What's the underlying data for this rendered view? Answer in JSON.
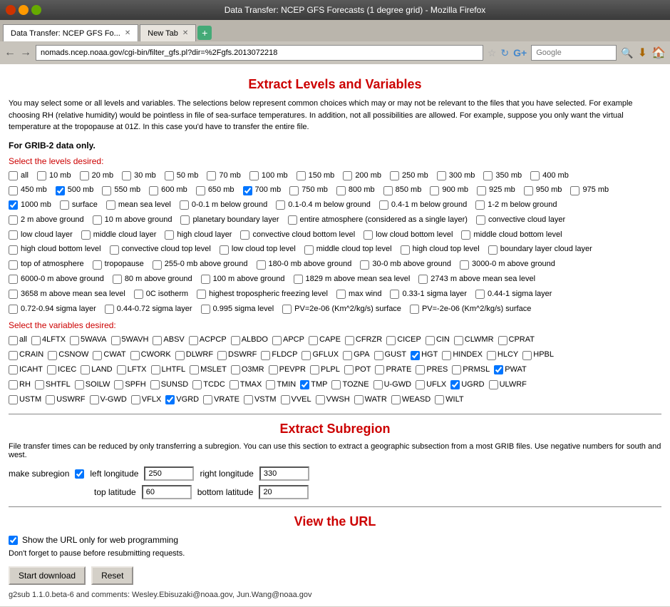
{
  "titlebar": {
    "title": "Data Transfer: NCEP GFS Forecasts (1 degree grid) - Mozilla Firefox"
  },
  "tabs": [
    {
      "label": "Data Transfer: NCEP GFS Fo...",
      "active": true
    },
    {
      "label": "New Tab",
      "active": false
    }
  ],
  "addressbar": {
    "url": "nomads.ncep.noaa.gov/cgi-bin/filter_gfs.pl?dir=%2Fgfs.2013072218",
    "search_placeholder": "Google"
  },
  "page": {
    "title": "Extract Levels and Variables",
    "description": "You may select some or all levels and variables. The selections below represent common choices which may or may not be relevant to the files that you have selected. For example choosing RH (relative humidity) would be pointless in file of sea-surface temperatures. In addition, not all possibilities are allowed. For example, suppose you only want the virtual temperature at the tropopause at 01Z. In this case you'd have to transfer the entire file.",
    "for_grib": "For GRIB-2 data only.",
    "select_levels_label": "Select the levels desired:",
    "select_vars_label": "Select the variables desired:",
    "subregion_title": "Extract Subregion",
    "url_title": "View the URL",
    "subregion_desc": "File transfer times can be reduced by only transferring a subregion. You can use this section to extract a geographic subsection from a most GRIB files. Use negative numbers for south and west.",
    "make_subregion_label": "make subregion",
    "left_lon_label": "left longitude",
    "right_lon_label": "right longitude",
    "top_lat_label": "top latitude",
    "bottom_lat_label": "bottom latitude",
    "left_lon_value": "250",
    "right_lon_value": "330",
    "top_lat_value": "60",
    "bottom_lat_value": "20",
    "show_url_label": "Show the URL only for web programming",
    "pause_note": "Don't forget to pause before resubmitting requests.",
    "start_btn": "Start download",
    "reset_btn": "Reset",
    "footer": "g2sub 1.1.0.beta-6 and comments: Wesley.Ebisuzaki@noaa.gov, Jun.Wang@noaa.gov"
  },
  "levels": [
    {
      "label": "all",
      "checked": false
    },
    {
      "label": "10 mb",
      "checked": false
    },
    {
      "label": "20 mb",
      "checked": false
    },
    {
      "label": "30 mb",
      "checked": false
    },
    {
      "label": "50 mb",
      "checked": false
    },
    {
      "label": "70 mb",
      "checked": false
    },
    {
      "label": "100 mb",
      "checked": false
    },
    {
      "label": "150 mb",
      "checked": false
    },
    {
      "label": "200 mb",
      "checked": false
    },
    {
      "label": "250 mb",
      "checked": false
    },
    {
      "label": "300 mb",
      "checked": false
    },
    {
      "label": "350 mb",
      "checked": false
    },
    {
      "label": "400 mb",
      "checked": false
    },
    {
      "label": "450 mb",
      "checked": false
    },
    {
      "label": "500 mb",
      "checked": true
    },
    {
      "label": "550 mb",
      "checked": false
    },
    {
      "label": "600 mb",
      "checked": false
    },
    {
      "label": "650 mb",
      "checked": false
    },
    {
      "label": "700 mb",
      "checked": true
    },
    {
      "label": "750 mb",
      "checked": false
    },
    {
      "label": "800 mb",
      "checked": false
    },
    {
      "label": "850 mb",
      "checked": false
    },
    {
      "label": "900 mb",
      "checked": false
    },
    {
      "label": "925 mb",
      "checked": false
    },
    {
      "label": "950 mb",
      "checked": false
    },
    {
      "label": "975 mb",
      "checked": false
    },
    {
      "label": "1000 mb",
      "checked": true
    },
    {
      "label": "surface",
      "checked": false
    },
    {
      "label": "mean sea level",
      "checked": false
    },
    {
      "label": "0-0.1 m below ground",
      "checked": false
    },
    {
      "label": "0.1-0.4 m below ground",
      "checked": false
    },
    {
      "label": "0.4-1 m below ground",
      "checked": false
    },
    {
      "label": "1-2 m below ground",
      "checked": false
    },
    {
      "label": "2 m above ground",
      "checked": false
    },
    {
      "label": "10 m above ground",
      "checked": false
    },
    {
      "label": "planetary boundary layer",
      "checked": false
    },
    {
      "label": "entire atmosphere (considered as a single layer)",
      "checked": false
    },
    {
      "label": "convective cloud layer",
      "checked": false
    },
    {
      "label": "low cloud layer",
      "checked": false
    },
    {
      "label": "middle cloud layer",
      "checked": false
    },
    {
      "label": "high cloud layer",
      "checked": false
    },
    {
      "label": "convective cloud bottom level",
      "checked": false
    },
    {
      "label": "low cloud bottom level",
      "checked": false
    },
    {
      "label": "middle cloud bottom level",
      "checked": false
    },
    {
      "label": "high cloud bottom level",
      "checked": false
    },
    {
      "label": "convective cloud top level",
      "checked": false
    },
    {
      "label": "low cloud top level",
      "checked": false
    },
    {
      "label": "middle cloud top level",
      "checked": false
    },
    {
      "label": "high cloud top level",
      "checked": false
    },
    {
      "label": "boundary layer cloud layer",
      "checked": false
    },
    {
      "label": "top of atmosphere",
      "checked": false
    },
    {
      "label": "tropopause",
      "checked": false
    },
    {
      "label": "255-0 mb above ground",
      "checked": false
    },
    {
      "label": "180-0 mb above ground",
      "checked": false
    },
    {
      "label": "30-0 mb above ground",
      "checked": false
    },
    {
      "label": "3000-0 m above ground",
      "checked": false
    },
    {
      "label": "6000-0 m above ground",
      "checked": false
    },
    {
      "label": "80 m above ground",
      "checked": false
    },
    {
      "label": "100 m above ground",
      "checked": false
    },
    {
      "label": "1829 m above mean sea level",
      "checked": false
    },
    {
      "label": "2743 m above mean sea level",
      "checked": false
    },
    {
      "label": "3658 m above mean sea level",
      "checked": false
    },
    {
      "label": "0C isotherm",
      "checked": false
    },
    {
      "label": "highest tropospheric freezing level",
      "checked": false
    },
    {
      "label": "max wind",
      "checked": false
    },
    {
      "label": "0.33-1 sigma layer",
      "checked": false
    },
    {
      "label": "0.44-1 sigma layer",
      "checked": false
    },
    {
      "label": "0.72-0.94 sigma layer",
      "checked": false
    },
    {
      "label": "0.44-0.72 sigma layer",
      "checked": false
    },
    {
      "label": "0.995 sigma level",
      "checked": false
    },
    {
      "label": "PV=2e-06 (Km^2/kg/s) surface",
      "checked": false
    },
    {
      "label": "PV=-2e-06 (Km^2/kg/s) surface",
      "checked": false
    }
  ],
  "variables": [
    {
      "label": "all",
      "checked": false
    },
    {
      "label": "4LFTX",
      "checked": false
    },
    {
      "label": "5WAVA",
      "checked": false
    },
    {
      "label": "5WAVH",
      "checked": false
    },
    {
      "label": "ABSV",
      "checked": false
    },
    {
      "label": "ACPCP",
      "checked": false
    },
    {
      "label": "ALBDO",
      "checked": false
    },
    {
      "label": "APCP",
      "checked": false
    },
    {
      "label": "CAPE",
      "checked": false
    },
    {
      "label": "CFRZR",
      "checked": false
    },
    {
      "label": "CICEP",
      "checked": false
    },
    {
      "label": "CIN",
      "checked": false
    },
    {
      "label": "CLWMR",
      "checked": false
    },
    {
      "label": "CPRAT",
      "checked": false
    },
    {
      "label": "CRAIN",
      "checked": false
    },
    {
      "label": "CSNOW",
      "checked": false
    },
    {
      "label": "CWAT",
      "checked": false
    },
    {
      "label": "CWORK",
      "checked": false
    },
    {
      "label": "DLWRF",
      "checked": false
    },
    {
      "label": "DSWRF",
      "checked": false
    },
    {
      "label": "FLDCP",
      "checked": false
    },
    {
      "label": "GFLUX",
      "checked": false
    },
    {
      "label": "GPA",
      "checked": false
    },
    {
      "label": "GUST",
      "checked": false
    },
    {
      "label": "HGT",
      "checked": true
    },
    {
      "label": "HINDEX",
      "checked": false
    },
    {
      "label": "HLCY",
      "checked": false
    },
    {
      "label": "HPBL",
      "checked": false
    },
    {
      "label": "ICAHT",
      "checked": false
    },
    {
      "label": "ICEC",
      "checked": false
    },
    {
      "label": "LAND",
      "checked": false
    },
    {
      "label": "LFTX",
      "checked": false
    },
    {
      "label": "LHTFL",
      "checked": false
    },
    {
      "label": "MSLET",
      "checked": false
    },
    {
      "label": "O3MR",
      "checked": false
    },
    {
      "label": "PEVPR",
      "checked": false
    },
    {
      "label": "PLPL",
      "checked": false
    },
    {
      "label": "POT",
      "checked": false
    },
    {
      "label": "PRATE",
      "checked": false
    },
    {
      "label": "PRES",
      "checked": false
    },
    {
      "label": "PRMSL",
      "checked": false
    },
    {
      "label": "PWAT",
      "checked": true
    },
    {
      "label": "RH",
      "checked": false
    },
    {
      "label": "SHTFL",
      "checked": false
    },
    {
      "label": "SOILW",
      "checked": false
    },
    {
      "label": "SPFH",
      "checked": false
    },
    {
      "label": "SUNSD",
      "checked": false
    },
    {
      "label": "TCDC",
      "checked": false
    },
    {
      "label": "TMAX",
      "checked": false
    },
    {
      "label": "TMIN",
      "checked": false
    },
    {
      "label": "TMP",
      "checked": true
    },
    {
      "label": "TOZNE",
      "checked": false
    },
    {
      "label": "U-GWD",
      "checked": false
    },
    {
      "label": "UFLX",
      "checked": false
    },
    {
      "label": "UGRD",
      "checked": true
    },
    {
      "label": "ULWRF",
      "checked": false
    },
    {
      "label": "USTM",
      "checked": false
    },
    {
      "label": "USWRF",
      "checked": false
    },
    {
      "label": "V-GWD",
      "checked": false
    },
    {
      "label": "VFLX",
      "checked": false
    },
    {
      "label": "VGRD",
      "checked": true
    },
    {
      "label": "VRATE",
      "checked": false
    },
    {
      "label": "VSTM",
      "checked": false
    },
    {
      "label": "VVEL",
      "checked": false
    },
    {
      "label": "VWSH",
      "checked": false
    },
    {
      "label": "WATR",
      "checked": false
    },
    {
      "label": "WEASD",
      "checked": false
    },
    {
      "label": "WILT",
      "checked": false
    }
  ]
}
